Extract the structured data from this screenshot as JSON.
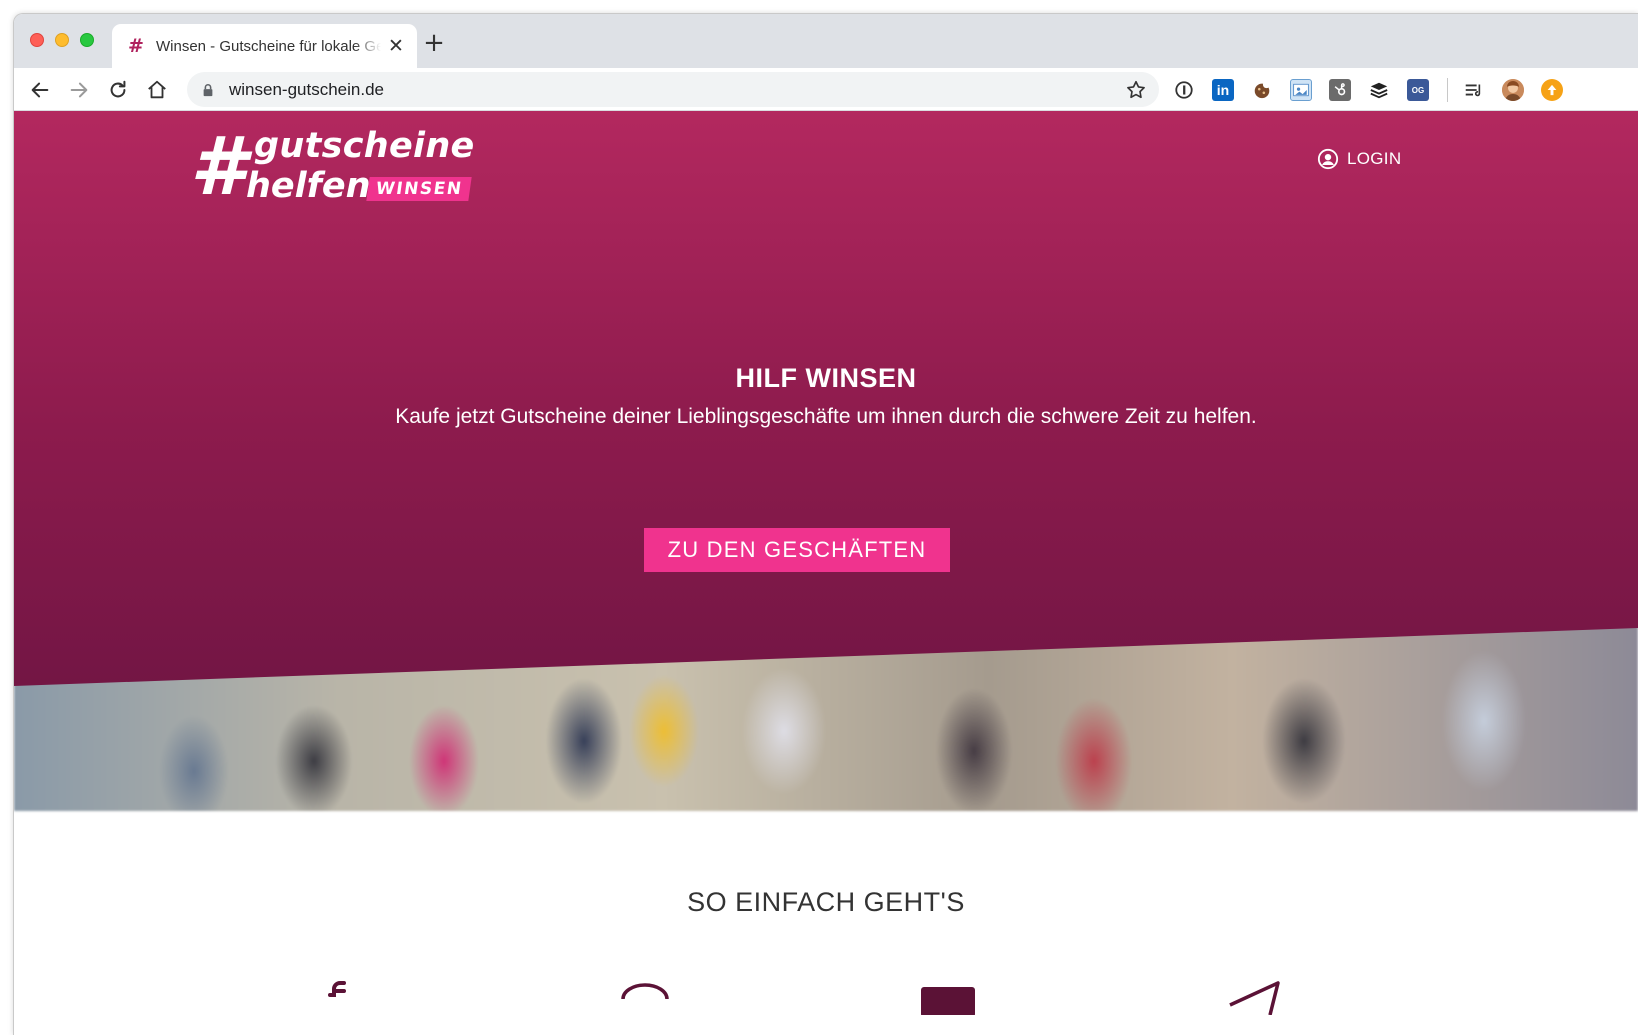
{
  "browser": {
    "tab": {
      "favicon": "#",
      "title": "Winsen - Gutscheine für lokale Geschäfte",
      "close": "✕"
    },
    "new_tab": "+",
    "address": {
      "url": "winsen-gutschein.de"
    },
    "extensions": [
      "1password-icon",
      "linkedin-icon",
      "cookie-icon",
      "image-ext-icon",
      "hubspot-icon",
      "buffer-icon",
      "og-icon",
      "reading-list-icon",
      "profile-avatar",
      "update-icon"
    ],
    "ext_labels": {
      "linkedin": "in",
      "og": "OG"
    },
    "colors": {
      "linkedin": "#0a66c2",
      "og": "#3b5998",
      "update": "#f6a216"
    }
  },
  "site": {
    "logo": {
      "hash": "#",
      "line1": "gutscheine",
      "line2": "helfen",
      "badge": "WINSEN"
    },
    "login_label": "LOGIN",
    "hero": {
      "title": "HILF WINSEN",
      "subtitle": "Kaufe jetzt Gutscheine deiner Lieblingsgeschäfte um ihnen durch die schwere Zeit zu helfen.",
      "cta_label": "ZU DEN GESCHÄFTEN"
    },
    "how_it_works": {
      "title": "SO EINFACH GEHT'S"
    },
    "colors": {
      "primary": "#b3285f",
      "dark": "#661340",
      "accent": "#f0338e"
    }
  }
}
